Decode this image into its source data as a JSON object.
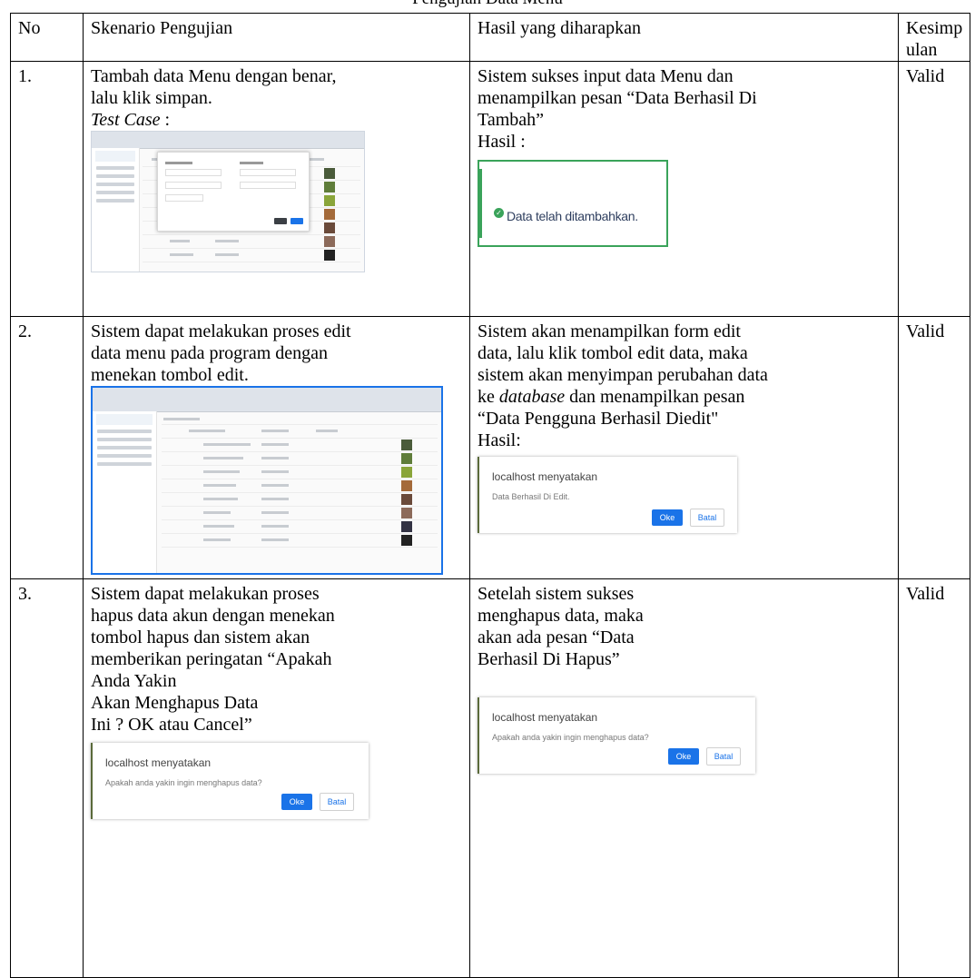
{
  "caption": "Pengujian Data Menu",
  "headers": {
    "no": "No",
    "skenario": "Skenario Pengujian",
    "hasil": "Hasil yang diharapkan",
    "kesimpulan_1": "Kesimp",
    "kesimpulan_2": "ulan"
  },
  "rows": [
    {
      "no": "1.",
      "skenario_1": "Tambah data Menu dengan benar,",
      "skenario_2": "lalu klik simpan.",
      "test_case": "Test Case",
      "test_case_colon": " :",
      "hasil_1": "Sistem sukses input data Menu dan",
      "hasil_2": "menampilkan pesan “Data Berhasil Di",
      "hasil_3": "Tambah”",
      "hasil_label": "Hasil :",
      "toast_text": "Data telah ditambahkan.",
      "kesimpulan": "Valid"
    },
    {
      "no": "2.",
      "skenario_1": "Sistem dapat melakukan proses edit",
      "skenario_2": "data menu pada program dengan",
      "skenario_3": "menekan tombol edit.",
      "hasil_1": "Sistem akan menampilkan form edit",
      "hasil_2": "data, lalu klik tombol edit data, maka",
      "hasil_3": "sistem akan menyimpan perubahan data",
      "hasil_4a": "ke ",
      "hasil_4b": "database",
      "hasil_4c": " dan menampilkan pesan",
      "hasil_5": "“Data Pengguna Berhasil Diedit\"",
      "hasil_label": "Hasil:",
      "dialog_title": "localhost menyatakan",
      "dialog_msg": "Data Berhasil Di Edit.",
      "ok": "Oke",
      "cancel": "Batal",
      "kesimpulan": "Valid"
    },
    {
      "no": "3.",
      "skenario_1": "Sistem dapat melakukan proses",
      "skenario_2": "hapus data akun dengan menekan",
      "skenario_3": "tombol hapus dan sistem akan",
      "skenario_4": "memberikan peringatan “Apakah",
      "skenario_5": "Anda Yakin",
      "skenario_6": "Akan Menghapus Data",
      "skenario_7": "Ini ? OK atau Cancel”",
      "hasil_1": "Setelah sistem sukses",
      "hasil_2": "menghapus data, maka",
      "hasil_3": "akan ada pesan “Data",
      "hasil_4": "Berhasil Di Hapus”",
      "dialog_title": "localhost menyatakan",
      "dialog_msg": "Apakah anda yakin ingin menghapus data?",
      "ok": "Oke",
      "cancel": "Batal",
      "kesimpulan": "Valid"
    }
  ]
}
